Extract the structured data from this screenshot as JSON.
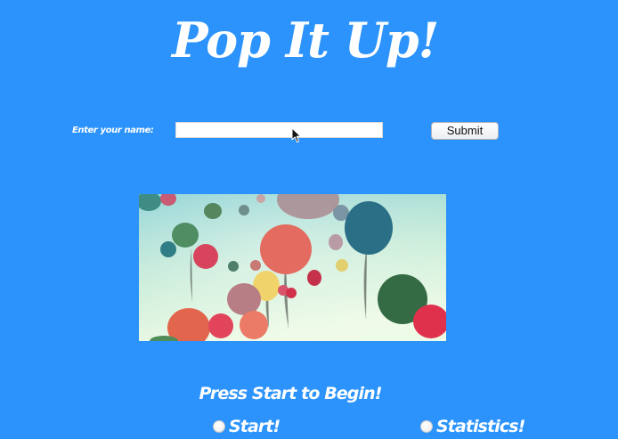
{
  "header": {
    "title": "Pop It Up!"
  },
  "name_form": {
    "label": "Enter your name:",
    "input_value": "",
    "submit_label": "Submit"
  },
  "hero_image": {
    "subject": "balloons-photo"
  },
  "menu": {
    "prompt": "Press Start to Begin!",
    "options": [
      {
        "label": "Start!",
        "selected": false
      },
      {
        "label": "Statistics!",
        "selected": false
      }
    ]
  },
  "colors": {
    "background": "#2b93fb",
    "text": "#ffffff",
    "input_background": "#ffffff"
  }
}
